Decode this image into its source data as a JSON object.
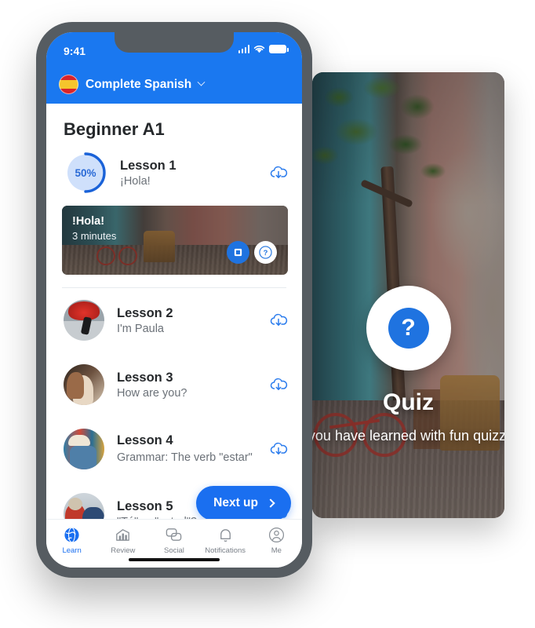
{
  "phone": {
    "status": {
      "time": "9:41",
      "signal_icon": "signal-bars-icon",
      "wifi_icon": "wifi-icon",
      "battery_icon": "battery-icon"
    },
    "appbar": {
      "flag_icon": "spain-flag-icon",
      "title": "Complete Spanish",
      "chevron_icon": "chevron-down-icon"
    },
    "page_title": "Beginner A1",
    "accent_color": "#1a78f0",
    "lesson_one": {
      "progress_label": "50%",
      "progress_value": 50,
      "title": "Lesson 1",
      "subtitle": "¡Hola!",
      "download_icon": "cloud-download-icon"
    },
    "media_card": {
      "title": "!Hola!",
      "duration": "3 minutes",
      "book_icon": "book-icon",
      "quiz_icon": "question-mark-icon"
    },
    "lessons": [
      {
        "title": "Lesson 2",
        "subtitle": "I'm Paula",
        "download_icon": "cloud-download-icon",
        "thumb": "thumb-flamenco"
      },
      {
        "title": "Lesson 3",
        "subtitle": "How are you?",
        "download_icon": "cloud-download-icon",
        "thumb": "thumb-couple"
      },
      {
        "title": "Lesson 4",
        "subtitle": "Grammar: The verb \"estar\"",
        "download_icon": "cloud-download-icon",
        "thumb": "thumb-man-reading"
      },
      {
        "title": "Lesson 5",
        "subtitle": "\"Tú\" or \"usted\"?",
        "download_icon": "cloud-download-icon",
        "thumb": "thumb-elderly-couple"
      }
    ],
    "next_up": {
      "label": "Next up",
      "chevron_icon": "chevron-right-icon"
    },
    "tabs": [
      {
        "label": "Learn",
        "icon": "globe-icon",
        "active": true
      },
      {
        "label": "Review",
        "icon": "bar-chart-icon",
        "active": false
      },
      {
        "label": "Social",
        "icon": "chat-bubbles-icon",
        "active": false
      },
      {
        "label": "Notifications",
        "icon": "bell-icon",
        "active": false
      },
      {
        "label": "Me",
        "icon": "person-circle-icon",
        "active": false
      }
    ]
  },
  "quiz_panel": {
    "badge_icon": "question-mark-icon",
    "title": "Quiz",
    "subtitle": "Test what you have learned with fun quizzes"
  }
}
